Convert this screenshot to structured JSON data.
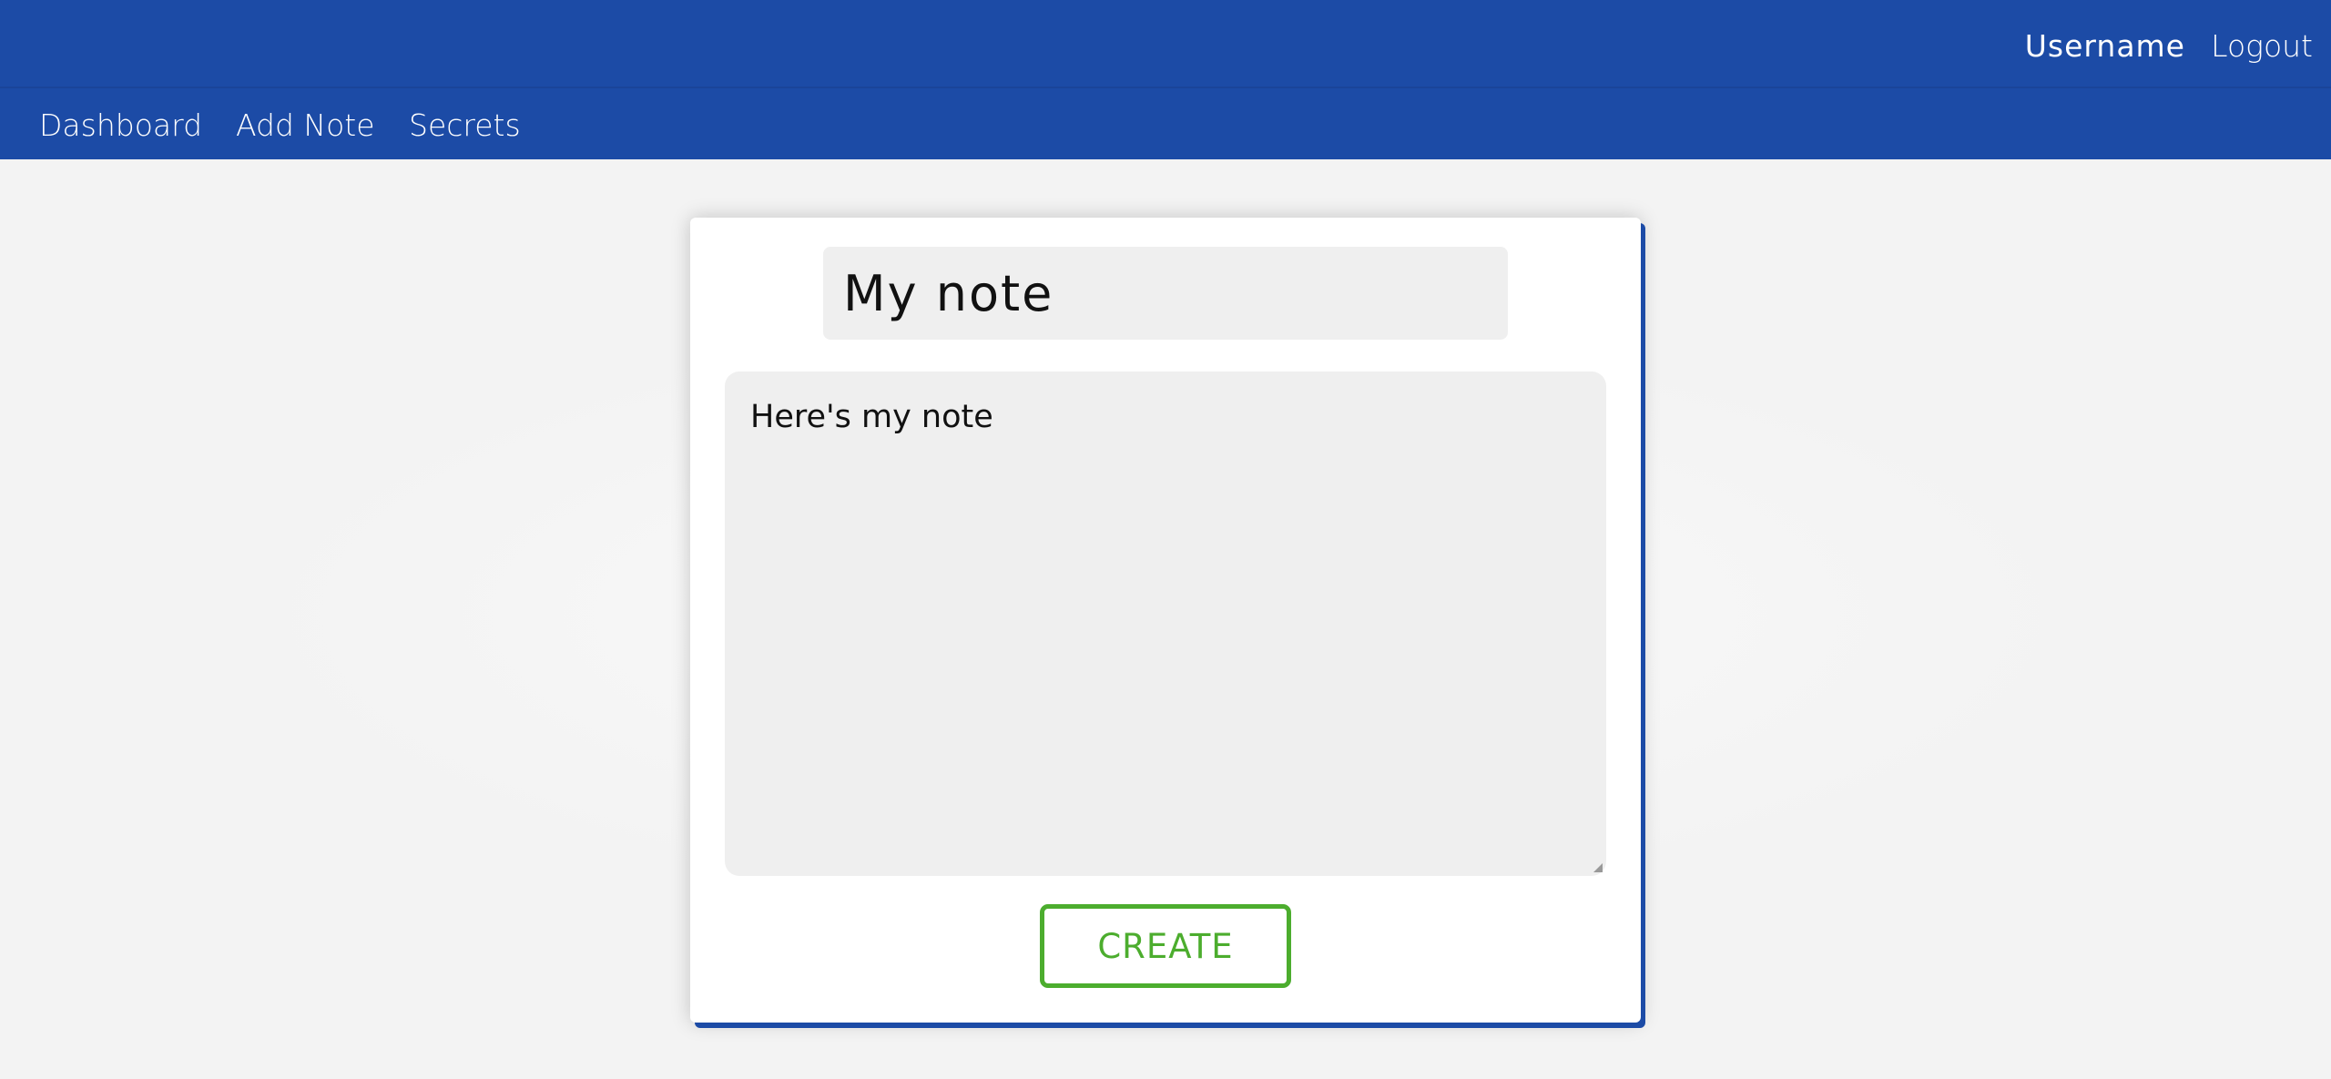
{
  "header": {
    "username": "Username",
    "logout_label": "Logout"
  },
  "nav": {
    "items": [
      {
        "label": "Dashboard"
      },
      {
        "label": "Add Note"
      },
      {
        "label": "Secrets"
      }
    ]
  },
  "note_form": {
    "title_value": "My note",
    "body_value": "Here's my note",
    "submit_label": "CREATE"
  },
  "colors": {
    "header_bg": "#1c4ba6",
    "page_bg": "#f3f3f3",
    "card_bg": "#ffffff",
    "input_bg": "#efefef",
    "button_accent": "#4cad2e"
  }
}
